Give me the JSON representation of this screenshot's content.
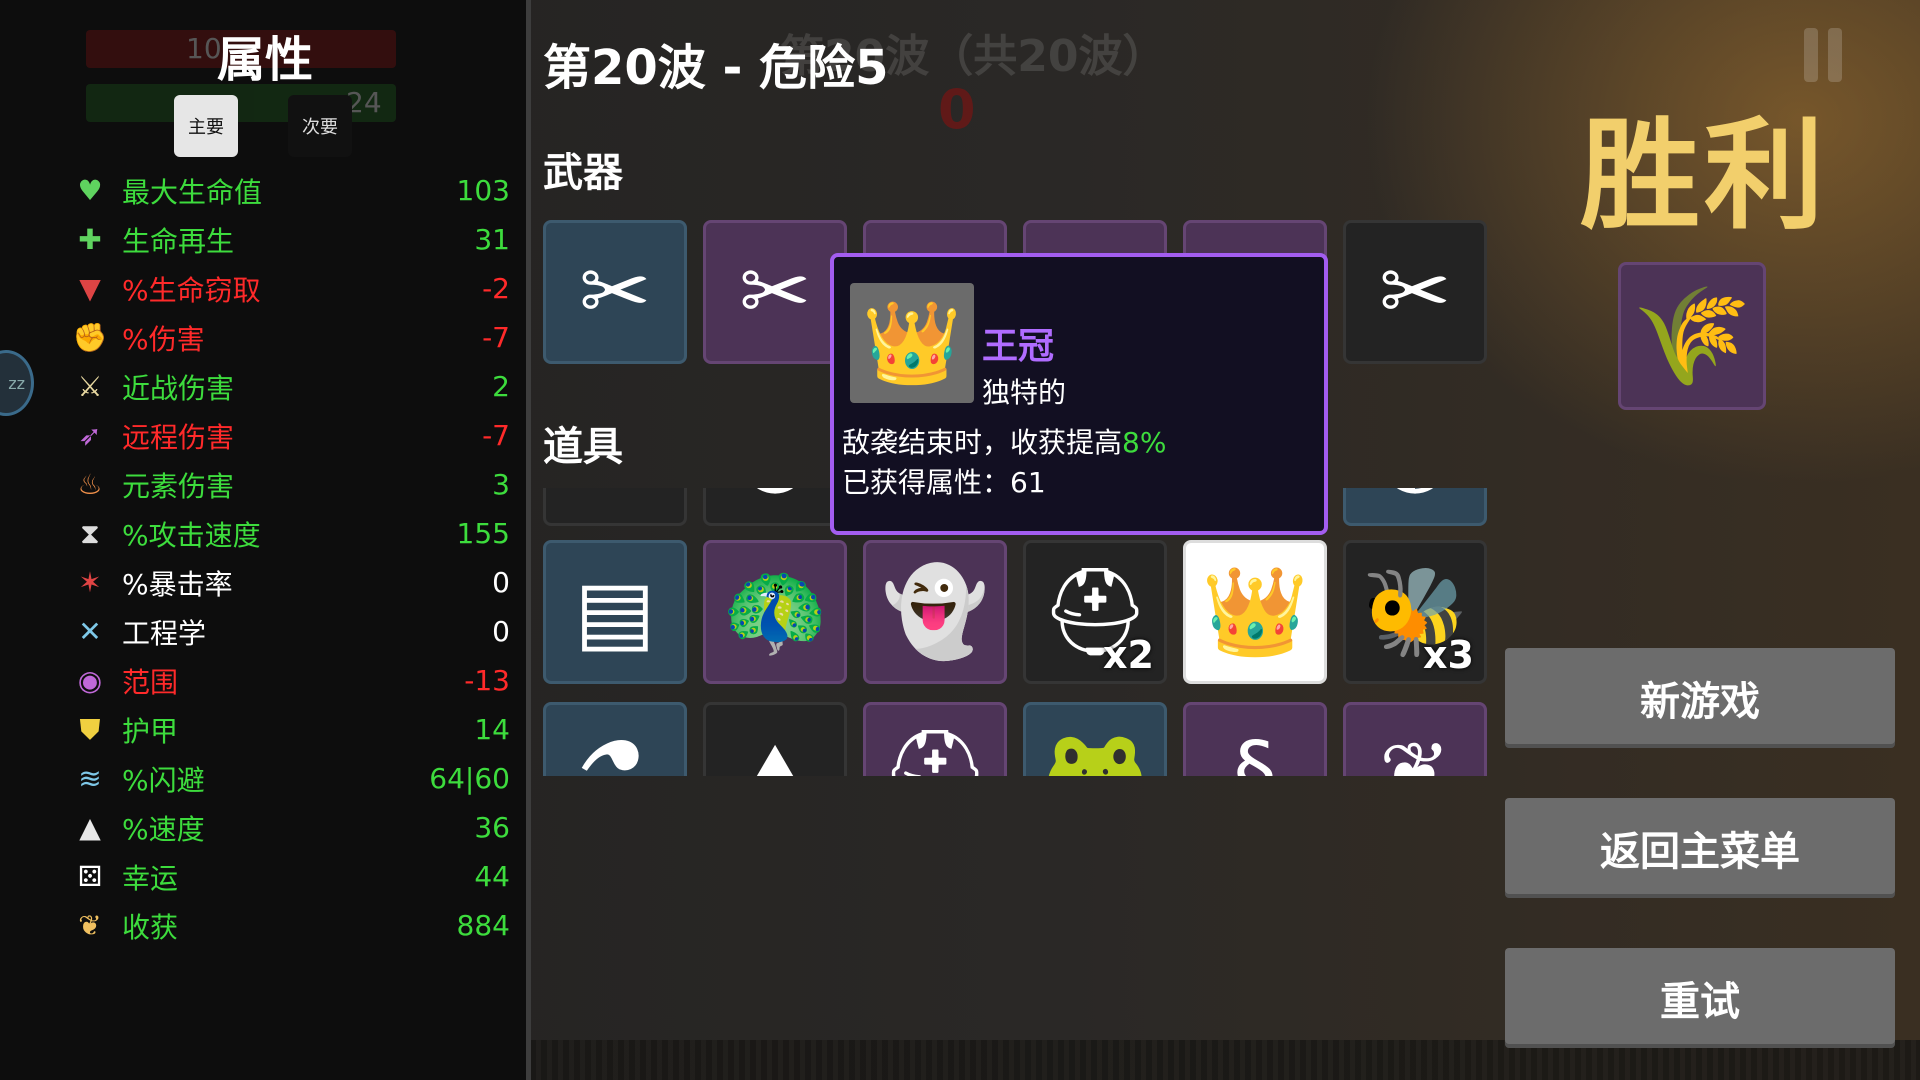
{
  "background": {
    "ghost_wave_text": "第20波（共20波）",
    "ghost_counter": "0",
    "bubble_text": "zz"
  },
  "left_panel": {
    "ghost_bars": [
      "10",
      "24"
    ],
    "title": "属性",
    "tabs": {
      "primary": "主要",
      "secondary": "次要"
    },
    "stats": [
      {
        "icon": "heart-icon",
        "glyph": "♥",
        "icon_color": "#5fd35f",
        "label": "最大生命值",
        "value": "103",
        "color": "#3ddc3d"
      },
      {
        "icon": "heal-plus-icon",
        "glyph": "✚",
        "icon_color": "#5fd35f",
        "label": "生命再生",
        "value": "31",
        "color": "#3ddc3d"
      },
      {
        "icon": "fangs-icon",
        "glyph": "▼",
        "icon_color": "#d44",
        "label": "%生命窃取",
        "value": "-2",
        "color": "#ff2a2a"
      },
      {
        "icon": "fist-icon",
        "glyph": "✊",
        "icon_color": "#e05555",
        "label": "%伤害",
        "value": "-7",
        "color": "#ff2a2a"
      },
      {
        "icon": "sword-icon",
        "glyph": "⚔",
        "icon_color": "#e8d8a0",
        "label": "近战伤害",
        "value": "2",
        "color": "#3ddc3d"
      },
      {
        "icon": "bow-icon",
        "glyph": "➶",
        "icon_color": "#c068d8",
        "label": "远程伤害",
        "value": "-7",
        "color": "#ff2a2a"
      },
      {
        "icon": "flame-icon",
        "glyph": "♨",
        "icon_color": "#f0904a",
        "label": "元素伤害",
        "value": "3",
        "color": "#3ddc3d"
      },
      {
        "icon": "hourglass-icon",
        "glyph": "⧗",
        "icon_color": "#dddddd",
        "label": "%攻击速度",
        "value": "155",
        "color": "#3ddc3d"
      },
      {
        "icon": "crit-star-icon",
        "glyph": "✶",
        "icon_color": "#e04444",
        "label": "%暴击率",
        "value": "0",
        "color": "#ffffff"
      },
      {
        "icon": "wrench-icon",
        "glyph": "✕",
        "icon_color": "#7ec8e8",
        "label": "工程学",
        "value": "0",
        "color": "#ffffff"
      },
      {
        "icon": "range-icon",
        "glyph": "◉",
        "icon_color": "#c068d8",
        "label": "范围",
        "value": "-13",
        "color": "#ff2a2a"
      },
      {
        "icon": "shield-icon",
        "glyph": "⛊",
        "icon_color": "#f0d040",
        "label": "护甲",
        "value": "14",
        "color": "#3ddc3d"
      },
      {
        "icon": "dodge-icon",
        "glyph": "≋",
        "icon_color": "#7ec8e8",
        "label": "%闪避",
        "value": "64|60",
        "color": "#3ddc3d"
      },
      {
        "icon": "boot-icon",
        "glyph": "▲",
        "icon_color": "#e8e8e8",
        "label": "%速度",
        "value": "36",
        "color": "#3ddc3d"
      },
      {
        "icon": "dice-icon",
        "glyph": "⚄",
        "icon_color": "#ffffff",
        "label": "幸运",
        "value": "44",
        "color": "#3ddc3d"
      },
      {
        "icon": "harvest-icon",
        "glyph": "❦",
        "icon_color": "#f0c060",
        "label": "收获",
        "value": "884",
        "color": "#3ddc3d"
      }
    ]
  },
  "main": {
    "wave_title": "第20波 - 危险5",
    "weapons_heading": "武器",
    "items_heading": "道具",
    "weapons": [
      {
        "name": "pruner-icon",
        "glyph": "✂",
        "bg": "blue"
      },
      {
        "name": "pruner-icon",
        "glyph": "✂",
        "bg": "purple"
      },
      {
        "name": "pruner-icon",
        "glyph": "✂",
        "bg": "purple"
      },
      {
        "name": "pruner-icon",
        "glyph": "✂",
        "bg": "purple"
      },
      {
        "name": "pruner-icon",
        "glyph": "✂",
        "bg": "purple"
      },
      {
        "name": "pruner-icon",
        "glyph": "✂",
        "bg": "dark"
      }
    ],
    "items_row1": [
      {
        "name": "hidden-item-icon",
        "glyph": "✦",
        "bg": "dark"
      },
      {
        "name": "hidden-item-icon",
        "glyph": "●",
        "bg": "dark"
      },
      {
        "name": "hidden-item-icon",
        "glyph": "",
        "bg": "dark"
      },
      {
        "name": "hidden-item-icon",
        "glyph": "",
        "bg": "dark"
      },
      {
        "name": "hidden-item-icon",
        "glyph": "",
        "bg": "dark"
      },
      {
        "name": "hidden-item-icon",
        "glyph": "◐",
        "bg": "blue"
      }
    ],
    "items_row2": [
      {
        "name": "box-icon",
        "glyph": "▤",
        "bg": "blue",
        "qty": ""
      },
      {
        "name": "peacock-icon",
        "glyph": "🦚",
        "bg": "purple",
        "qty": ""
      },
      {
        "name": "ghost-icon",
        "glyph": "👻",
        "bg": "purple",
        "qty": ""
      },
      {
        "name": "helmet-icon",
        "glyph": "⛑",
        "bg": "dark",
        "qty": "x2"
      },
      {
        "name": "crown-icon",
        "glyph": "👑",
        "bg": "white",
        "qty": ""
      },
      {
        "name": "bee-icon",
        "glyph": "🐝",
        "bg": "dark",
        "qty": "x3"
      }
    ],
    "items_row3": [
      {
        "name": "potion-icon",
        "glyph": "⚗",
        "bg": "blue"
      },
      {
        "name": "wizard-hat-icon",
        "glyph": "⛰",
        "bg": "dark"
      },
      {
        "name": "knight-helmet-icon",
        "glyph": "⛑",
        "bg": "purple"
      },
      {
        "name": "frog-icon",
        "glyph": "🐸",
        "bg": "blue"
      },
      {
        "name": "worms-icon",
        "glyph": "§",
        "bg": "purple"
      },
      {
        "name": "wings-icon",
        "glyph": "❦",
        "bg": "purple"
      }
    ]
  },
  "tooltip": {
    "icon": "crown-icon",
    "glyph": "👑",
    "name": "王冠",
    "rarity": "独特的",
    "desc_prefix": "敌袭结束时，收获提高",
    "desc_value": "8%",
    "obtained": "已获得属性：61"
  },
  "right_panel": {
    "victory": "胜利",
    "reward": {
      "icon": "wheat-icon",
      "glyph": "🌾"
    },
    "buttons": {
      "new_game": "新游戏",
      "main_menu": "返回主菜单",
      "retry": "重试"
    }
  }
}
